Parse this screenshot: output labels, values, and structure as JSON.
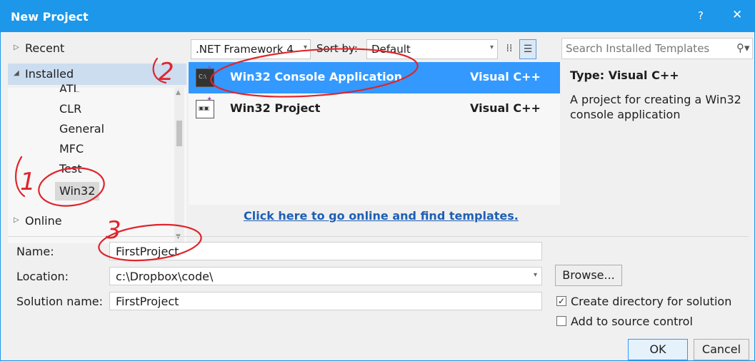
{
  "window": {
    "title": "New Project",
    "help_label": "?",
    "close_label": "✕"
  },
  "tree": {
    "recent_label": "Recent",
    "installed_label": "Installed",
    "online_label": "Online",
    "sub_items": [
      "ATL",
      "CLR",
      "General",
      "MFC",
      "Test",
      "Win32"
    ],
    "selected_sub_item": "Win32"
  },
  "toolbar": {
    "framework_value": ".NET Framework 4",
    "sort_label": "Sort by:",
    "sort_value": "Default"
  },
  "templates": [
    {
      "name": "Win32 Console Application",
      "language": "Visual C++",
      "icon": "console-app-icon",
      "selected": true
    },
    {
      "name": "Win32 Project",
      "language": "Visual C++",
      "icon": "win32-project-icon",
      "selected": false
    }
  ],
  "online_link": "Click here to go online and find templates.",
  "search": {
    "placeholder": "Search Installed Templates"
  },
  "description": {
    "type_line": "Type:  Visual C++",
    "text": "A project for creating a Win32 console application"
  },
  "form": {
    "name_label": "Name:",
    "name_value": "FirstProject",
    "location_label": "Location:",
    "location_value": "c:\\Dropbox\\code\\",
    "solution_label": "Solution name:",
    "solution_value": "FirstProject",
    "browse_label": "Browse...",
    "create_dir_label": "Create directory for solution",
    "create_dir_checked": true,
    "source_control_label": "Add to source control",
    "source_control_checked": false
  },
  "buttons": {
    "ok_label": "OK",
    "cancel_label": "Cancel"
  },
  "annotations": [
    "1",
    "2",
    "3"
  ],
  "colors": {
    "accent": "#1c97ea",
    "selection": "#3399ff",
    "annotation": "#e0242b",
    "link": "#1e5fb4"
  }
}
